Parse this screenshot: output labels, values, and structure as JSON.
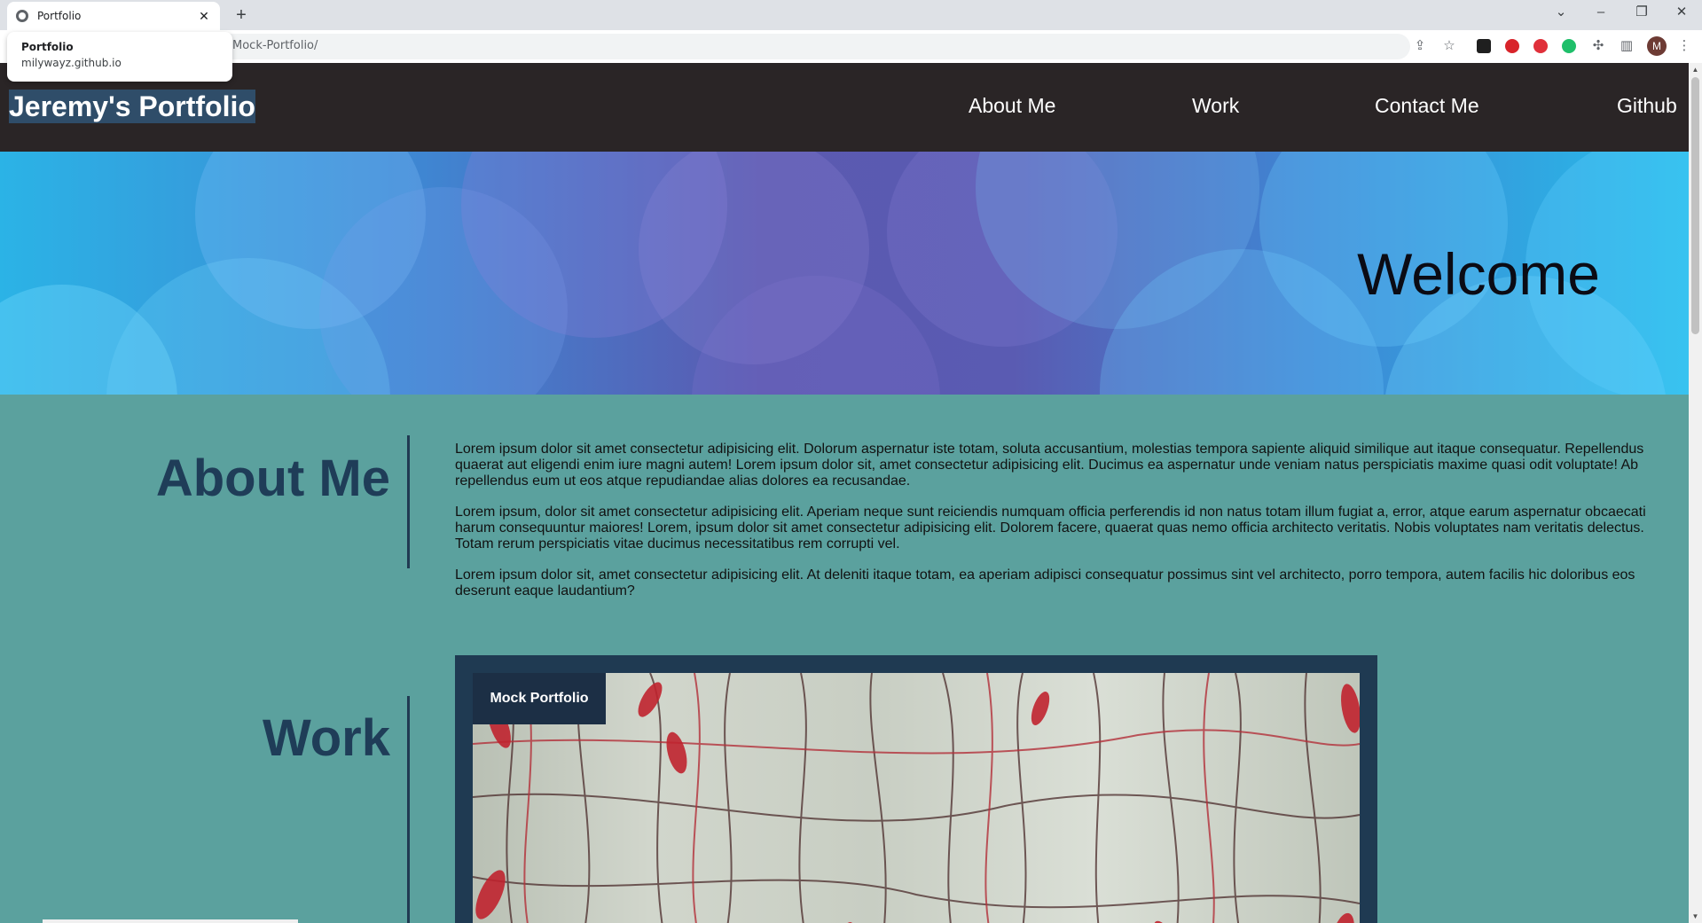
{
  "browser": {
    "tab_title": "Portfolio",
    "url": "Mock-Portfolio/",
    "hovercard": {
      "title": "Portfolio",
      "domain": "milywayz.github.io"
    },
    "avatar_letter": "M",
    "new_tab_glyph": "+",
    "close_glyph": "✕"
  },
  "site": {
    "brand": "Jeremy's Portfolio",
    "nav": [
      "About Me",
      "Work",
      "Contact Me",
      "Github"
    ]
  },
  "hero": {
    "title": "Welcome"
  },
  "about": {
    "heading": "About Me",
    "paragraphs": [
      "Lorem ipsum dolor sit amet consectetur adipisicing elit. Dolorum aspernatur iste totam, soluta accusantium, molestias tempora sapiente aliquid similique aut itaque consequatur. Repellendus quaerat aut eligendi enim iure magni autem! Lorem ipsum dolor sit, amet consectetur adipisicing elit. Ducimus ea aspernatur unde veniam natus perspiciatis maxime quasi odit voluptate! Ab repellendus eum ut eos atque repudiandae alias dolores ea recusandae.",
      "Lorem ipsum, dolor sit amet consectetur adipisicing elit. Aperiam neque sunt reiciendis numquam officia perferendis id non natus totam illum fugiat a, error, atque earum aspernatur obcaecati harum consequuntur maiores! Lorem, ipsum dolor sit amet consectetur adipisicing elit. Dolorem facere, quaerat quas nemo officia architecto veritatis. Nobis voluptates nam veritatis delectus. Totam rerum perspiciatis vitae ducimus necessitatibus rem corrupti vel.",
      "Lorem ipsum dolor sit, amet consectetur adipisicing elit. At deleniti itaque totam, ea aperiam adipisci consequatur possimus sint vel architecto, porro tempora, autem facilis hic doloribus eos deserunt eaque laudantium?"
    ]
  },
  "work": {
    "heading": "Work",
    "card_label": "Mock Portfolio"
  },
  "colors": {
    "header_bg": "#2a2526",
    "page_bg": "#5ba19e",
    "heading": "#1f3d58",
    "card_bg": "#1f3a52"
  },
  "icons": [
    "globe-icon",
    "close-icon",
    "plus-icon",
    "chevron-down-icon",
    "minimize-icon",
    "restore-icon",
    "share-icon",
    "star-icon",
    "puzzle-icon",
    "sidebar-icon",
    "kebab-menu-icon"
  ]
}
